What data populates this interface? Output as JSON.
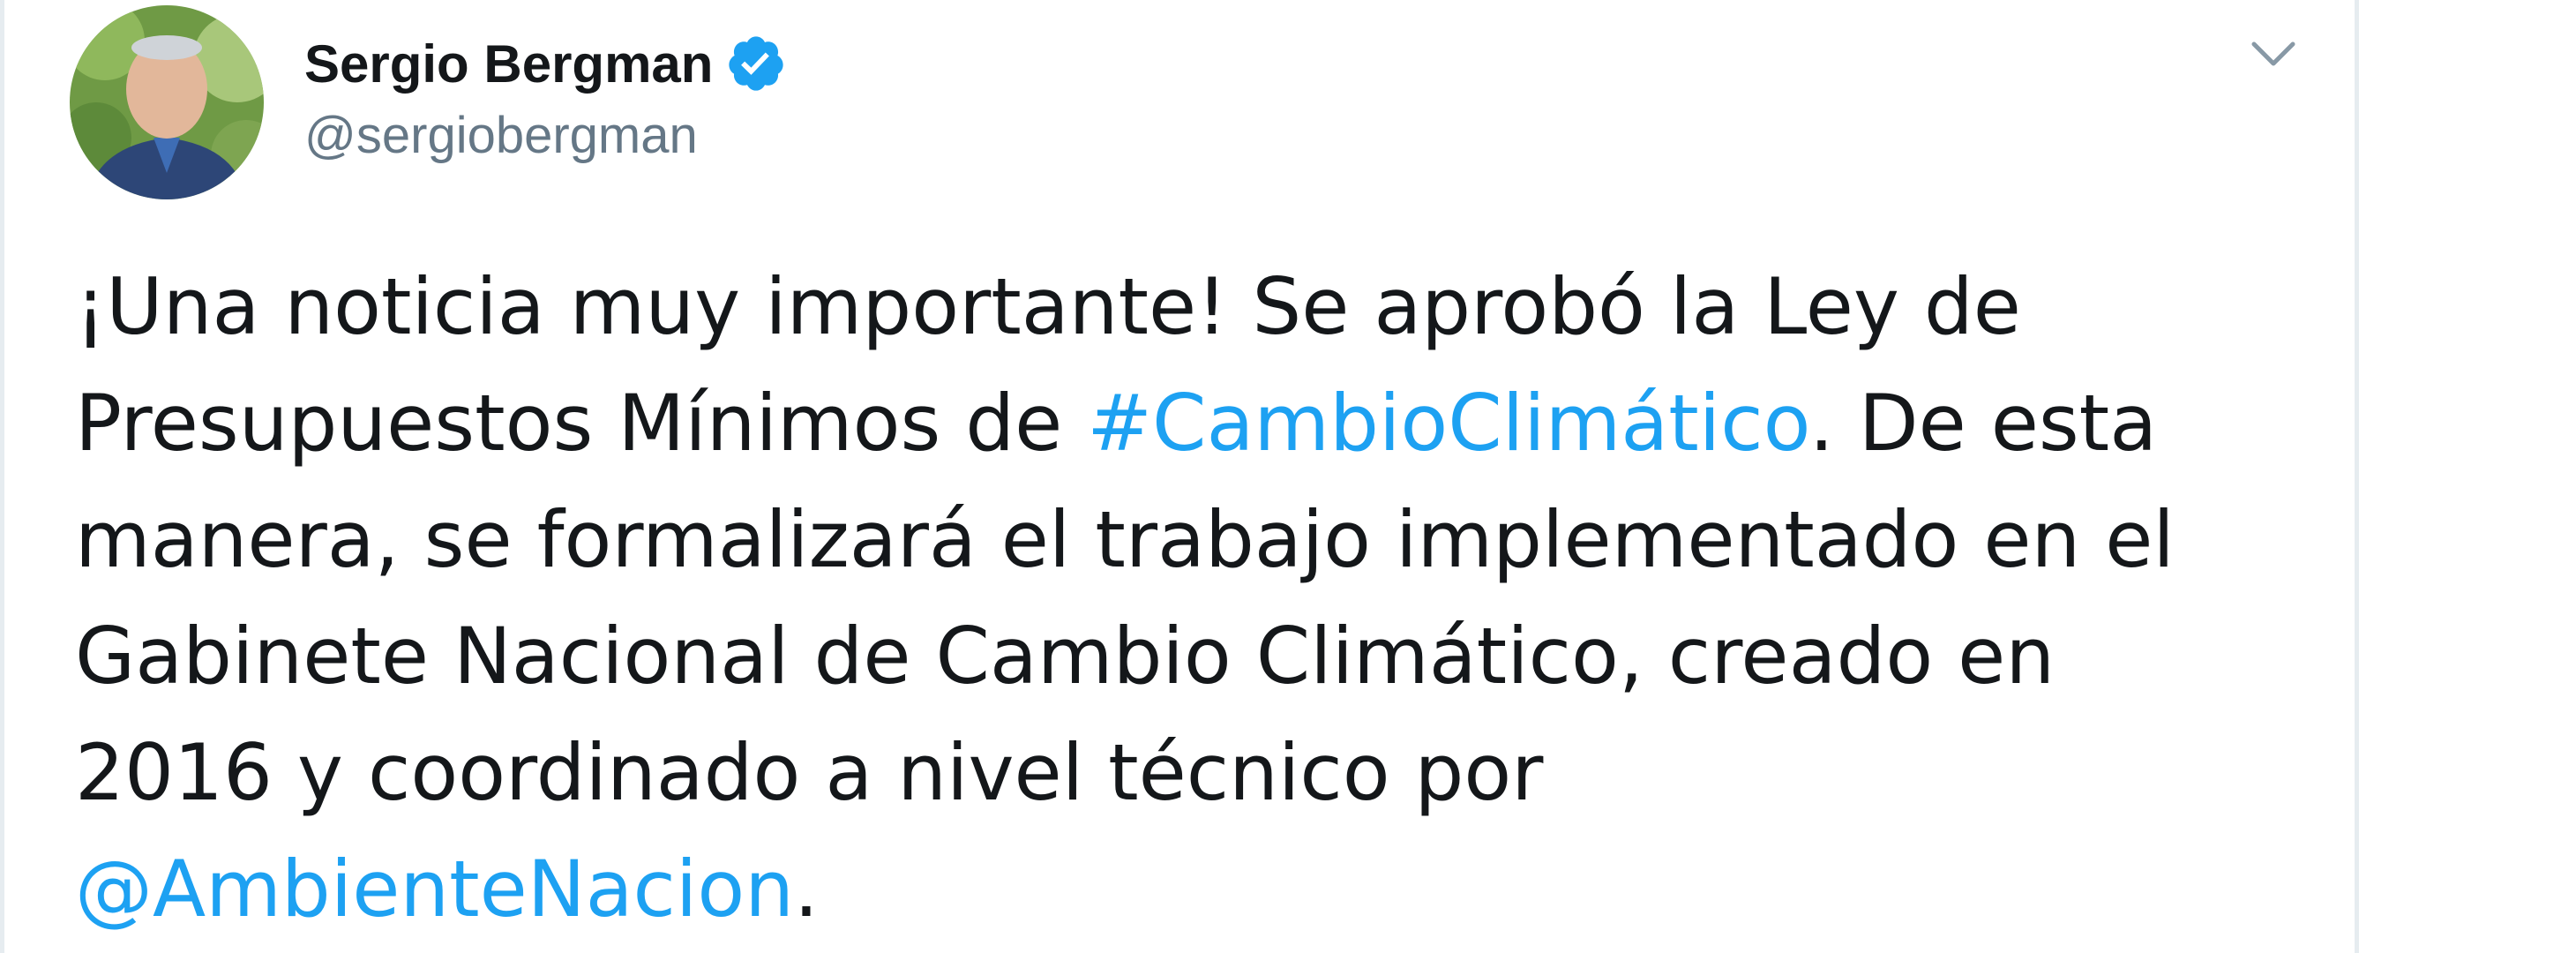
{
  "author": {
    "name": "Sergio Bergman",
    "handle": "@sergiobergman",
    "verified_icon": "verified-badge-icon"
  },
  "menu": {
    "icon": "chevron-down-icon"
  },
  "tweet": {
    "line1": "¡Una noticia muy importante! Se aprobó la Ley de",
    "line2_pre": "Presupuestos Mínimos de ",
    "hashtag": "#CambioClimático",
    "line2_post": ". De esta",
    "line3": "manera, se formalizará el trabajo implementado en el",
    "line4": "Gabinete Nacional de Cambio Climático, creado en",
    "line5": "2016 y coordinado a nivel técnico por",
    "mention": "@AmbienteNacion",
    "period": "."
  },
  "colors": {
    "link": "#1da1f2",
    "text": "#14171a",
    "secondary": "#657786",
    "border": "#e6ecf0"
  }
}
